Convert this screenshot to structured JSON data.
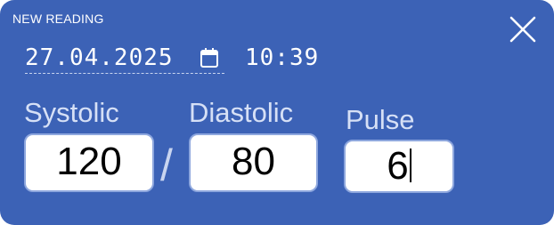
{
  "dialog": {
    "title": "NEW READING",
    "close_icon": "close-icon"
  },
  "datetime": {
    "date": "27.04.2025",
    "time": "10:39",
    "calendar_icon": "calendar-icon"
  },
  "fields": {
    "systolic": {
      "label": "Systolic",
      "value": "120"
    },
    "separator": "/",
    "diastolic": {
      "label": "Diastolic",
      "value": "80"
    },
    "pulse": {
      "label": "Pulse",
      "value": "6"
    }
  },
  "colors": {
    "panel": "#3c62b6",
    "label": "#d6e0f6",
    "input_border": "#8ea7de"
  }
}
